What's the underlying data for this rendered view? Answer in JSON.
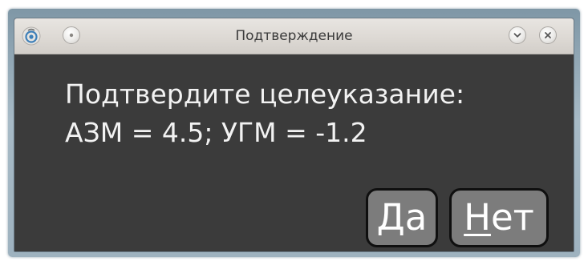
{
  "window": {
    "title": "Подтверждение"
  },
  "titlebar": {
    "left_buttons": [
      "app-menu-icon",
      "sticky-icon"
    ],
    "right_buttons": [
      "minimize-chevron-icon",
      "close-icon"
    ]
  },
  "message": {
    "line1": "Подтвердите целеуказание:",
    "line2": "АЗМ = 4.5; УГМ = -1.2"
  },
  "buttons": {
    "yes": {
      "mnemonic": "Д",
      "rest": "а"
    },
    "no": {
      "mnemonic": "Н",
      "rest": "ет"
    }
  },
  "colors": {
    "content_bg": "#3b3b3b",
    "button_bg": "#7c7c7c",
    "text": "#f2f2f2"
  }
}
